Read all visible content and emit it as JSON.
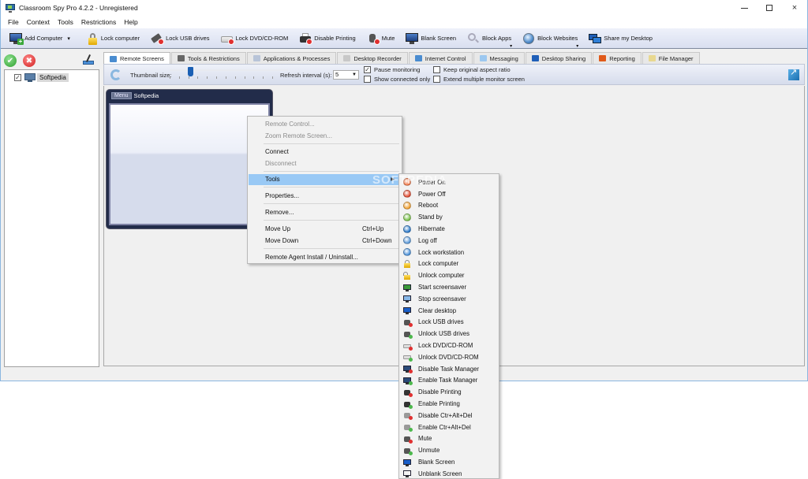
{
  "window": {
    "title": "Classroom Spy Pro 4.2.2 - Unregistered",
    "controls": {
      "minimize": "minimize",
      "maximize": "maximize",
      "close": "×"
    }
  },
  "menubar": [
    "File",
    "Context",
    "Tools",
    "Restrictions",
    "Help"
  ],
  "toolbar": {
    "add_computer": "Add Computer",
    "lock_computer": "Lock computer",
    "lock_usb": "Lock USB drives",
    "lock_dvd": "Lock DVD/CD-ROM",
    "disable_printing": "Disable Printing",
    "mute": "Mute",
    "blank_screen": "Blank Screen",
    "block_apps": "Block Apps",
    "block_websites": "Block Websites",
    "share_desktop": "Share my Desktop",
    "dropdown_glyph": "▾"
  },
  "sidebar": {
    "ok_glyph": "✔",
    "cancel_glyph": "✖",
    "computers": [
      {
        "name": "Softpedia",
        "checked": true,
        "check_glyph": "✓"
      }
    ]
  },
  "tabs": [
    {
      "label": "Remote Screens",
      "active": true,
      "icon_color": "#4a8cd0"
    },
    {
      "label": "Tools & Restrictions",
      "active": false,
      "icon_color": "#666666"
    },
    {
      "label": "Applications & Processes",
      "active": false,
      "icon_color": "#b8c4d8"
    },
    {
      "label": "Desktop Recorder",
      "active": false,
      "icon_color": "#c8c8c8"
    },
    {
      "label": "Internet Control",
      "active": false,
      "icon_color": "#4a8cd0"
    },
    {
      "label": "Messaging",
      "active": false,
      "icon_color": "#9cc8f0"
    },
    {
      "label": "Desktop Sharing",
      "active": false,
      "icon_color": "#1f5fb8"
    },
    {
      "label": "Reporting",
      "active": false,
      "icon_color": "#e05a1a"
    },
    {
      "label": "File Manager",
      "active": false,
      "icon_color": "#e8d890"
    }
  ],
  "options": {
    "thumbnail_size_label": "Thumbnail size:",
    "thumbnail_size_fraction": 0.2,
    "thumbnail_ticks": 12,
    "refresh_label": "Refresh interval (s):",
    "refresh_value": "5",
    "dropdown_arrow": "▼",
    "pause_monitoring": {
      "label": "Pause monitoring",
      "checked": true
    },
    "show_connected_only": {
      "label": "Show connected only",
      "checked": false
    },
    "keep_aspect": {
      "label": "Keep original aspect ratio",
      "checked": false
    },
    "extend_monitor": {
      "label": "Extend multiple monitor screen",
      "checked": false
    },
    "check_glyph": "✓"
  },
  "thumbnail": {
    "menu_label": "Menu",
    "name": "Softpedia"
  },
  "context_menu": {
    "items": [
      {
        "label": "Remote Control...",
        "disabled": true
      },
      {
        "label": "Zoom Remote Screen...",
        "disabled": true
      },
      {
        "label": "Connect",
        "disabled": false
      },
      {
        "label": "Disconnect",
        "disabled": true
      },
      {
        "label": "Tools",
        "disabled": false,
        "highlighted": true,
        "submenu_arrow": "▶"
      },
      {
        "label": "Properties...",
        "disabled": false
      },
      {
        "label": "Remove...",
        "disabled": false
      },
      {
        "label": "Move Up",
        "shortcut": "Ctrl+Up"
      },
      {
        "label": "Move Down",
        "shortcut": "Ctrl+Down"
      },
      {
        "label": "Remote Agent Install / Uninstall..."
      }
    ]
  },
  "watermark": "SOFTPEDIA",
  "tools_submenu": [
    {
      "label": "Power On",
      "icon": "power-on-icon",
      "color": "#f07848"
    },
    {
      "label": "Power Off",
      "icon": "power-off-icon",
      "color": "#e04a30"
    },
    {
      "label": "Reboot",
      "icon": "reboot-icon",
      "color": "#f0a030"
    },
    {
      "label": "Stand by",
      "icon": "standby-icon",
      "color": "#78c048"
    },
    {
      "label": "Hibernate",
      "icon": "hibernate-icon",
      "color": "#2a78c8"
    },
    {
      "label": "Log off",
      "icon": "log-off-icon",
      "color": "#5a98d8"
    },
    {
      "label": "Lock workstation",
      "icon": "lock-workstation-icon",
      "color": "#4a90d8"
    },
    {
      "label": "Lock computer",
      "icon": "lock-icon",
      "color": "#e8b800"
    },
    {
      "label": "Unlock computer",
      "icon": "unlock-icon",
      "color": "#e8b800"
    },
    {
      "label": "Start screensaver",
      "icon": "start-screensaver-icon",
      "color": "#3a9a3a"
    },
    {
      "label": "Stop screensaver",
      "icon": "stop-screensaver-icon",
      "color": "#88b8e8"
    },
    {
      "label": "Clear desktop",
      "icon": "clear-desktop-icon",
      "color": "#1a5fc8"
    },
    {
      "label": "Lock USB drives",
      "icon": "lock-usb-icon",
      "color": "#555555",
      "badge": "#e03030"
    },
    {
      "label": "Unlock USB drives",
      "icon": "unlock-usb-icon",
      "color": "#555555",
      "badge": "#4cb84c"
    },
    {
      "label": "Lock DVD/CD-ROM",
      "icon": "lock-dvd-icon",
      "color": "#dddddd",
      "badge": "#e03030"
    },
    {
      "label": "Unlock DVD/CD-ROM",
      "icon": "unlock-dvd-icon",
      "color": "#dddddd",
      "badge": "#4cb84c"
    },
    {
      "label": "Disable Task Manager",
      "icon": "disable-task-manager-icon",
      "color": "#2a4a78",
      "badge": "#e03030"
    },
    {
      "label": "Enable Task Manager",
      "icon": "enable-task-manager-icon",
      "color": "#2a4a78",
      "badge": "#4cb84c"
    },
    {
      "label": "Disable Printing",
      "icon": "disable-printing-icon",
      "color": "#333333",
      "badge": "#e03030"
    },
    {
      "label": "Enable Printing",
      "icon": "enable-printing-icon",
      "color": "#333333",
      "badge": "#4cb84c"
    },
    {
      "label": "Disable Ctr+Alt+Del",
      "icon": "disable-cad-icon",
      "color": "#999999",
      "badge": "#e03030"
    },
    {
      "label": "Enable Ctr+Alt+Del",
      "icon": "enable-cad-icon",
      "color": "#999999",
      "badge": "#4cb84c"
    },
    {
      "label": "Mute",
      "icon": "mute-icon",
      "color": "#555555",
      "badge": "#e03030"
    },
    {
      "label": "Unmute",
      "icon": "unmute-icon",
      "color": "#555555",
      "badge": "#4cb84c"
    },
    {
      "label": "Blank Screen",
      "icon": "blank-screen-icon",
      "color": "#1a5fc8"
    },
    {
      "label": "Unblank Screen",
      "icon": "unblank-screen-icon",
      "color": "#f4f4f4"
    }
  ]
}
